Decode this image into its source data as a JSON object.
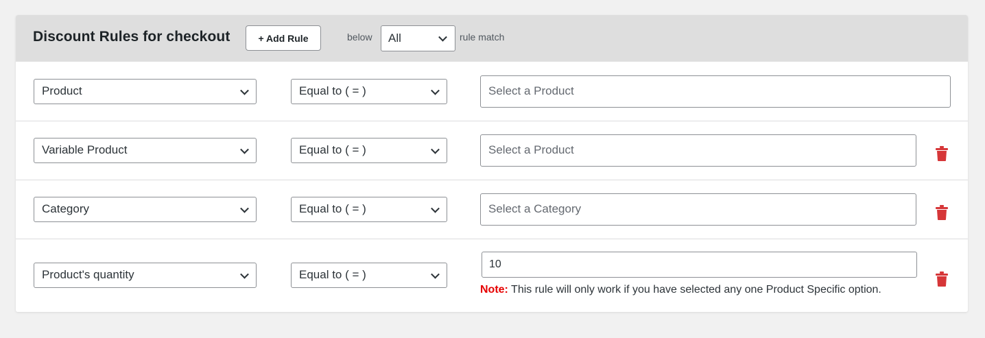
{
  "header": {
    "title": "Discount Rules for checkout",
    "add_rule_label": "+ Add Rule",
    "below_text": "below",
    "match_value": "All",
    "rule_match_text": "rule match"
  },
  "rules": [
    {
      "type": "Product",
      "operator": "Equal to ( = )",
      "value_placeholder": "Select a Product",
      "deletable": false
    },
    {
      "type": "Variable Product",
      "operator": "Equal to ( = )",
      "value_placeholder": "Select a Product",
      "deletable": true
    },
    {
      "type": "Category",
      "operator": "Equal to ( = )",
      "value_placeholder": "Select a Category",
      "deletable": true
    },
    {
      "type": "Product's quantity",
      "operator": "Equal to ( = )",
      "value": "10",
      "deletable": true
    }
  ],
  "note": {
    "label": "Note:",
    "text": "This rule will only work if you have selected any one Product Specific option."
  },
  "colors": {
    "header_bg": "#dedede",
    "delete_icon": "#d63638",
    "note_label": "#e60000"
  },
  "icons": {
    "delete": "trash-icon",
    "dropdown": "chevron-down-icon"
  }
}
